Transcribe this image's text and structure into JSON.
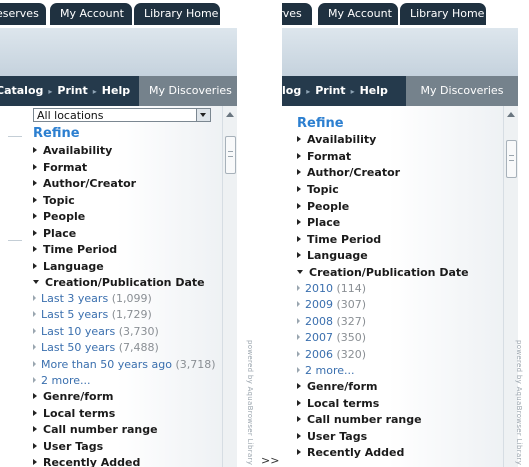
{
  "left": {
    "tabs": [
      {
        "label": "eserves"
      },
      {
        "label": "My Account"
      },
      {
        "label": "Library Home"
      }
    ],
    "nav": {
      "crumbs": [
        {
          "label": "Catalog"
        },
        {
          "label": "Print"
        },
        {
          "label": "Help"
        }
      ],
      "discoveries": "My Discoveries"
    },
    "location_select": {
      "value": "All locations"
    },
    "refine_title": "Refine",
    "facets_before": [
      {
        "label": "Availability"
      },
      {
        "label": "Format"
      },
      {
        "label": "Author/Creator"
      },
      {
        "label": "Topic"
      },
      {
        "label": "People"
      },
      {
        "label": "Place"
      },
      {
        "label": "Time Period"
      },
      {
        "label": "Language"
      }
    ],
    "open_facet": {
      "label": "Creation/Publication Date"
    },
    "sub_items": [
      {
        "label": "Last 3 years",
        "count": "(1,099)"
      },
      {
        "label": "Last 5 years",
        "count": "(1,729)"
      },
      {
        "label": "Last 10 years",
        "count": "(3,730)"
      },
      {
        "label": "Last 50 years",
        "count": "(7,488)"
      },
      {
        "label": "More than 50 years ago",
        "count": "(3,718)"
      }
    ],
    "more_link": "2 more...",
    "facets_after": [
      {
        "label": "Genre/form"
      },
      {
        "label": "Local terms"
      },
      {
        "label": "Call number range"
      },
      {
        "label": "User Tags"
      },
      {
        "label": "Recently Added"
      }
    ]
  },
  "right": {
    "tabs": [
      {
        "label": "rves"
      },
      {
        "label": "My Account"
      },
      {
        "label": "Library Home"
      }
    ],
    "nav": {
      "crumbs": [
        {
          "label": "log"
        },
        {
          "label": "Print"
        },
        {
          "label": "Help"
        }
      ],
      "discoveries": "My Discoveries"
    },
    "refine_title": "Refine",
    "facets_before": [
      {
        "label": "Availability"
      },
      {
        "label": "Format"
      },
      {
        "label": "Author/Creator"
      },
      {
        "label": "Topic"
      },
      {
        "label": "People"
      },
      {
        "label": "Place"
      },
      {
        "label": "Time Period"
      },
      {
        "label": "Language"
      }
    ],
    "open_facet": {
      "label": "Creation/Publication Date"
    },
    "sub_items": [
      {
        "label": "2010",
        "count": "(114)"
      },
      {
        "label": "2009",
        "count": "(307)"
      },
      {
        "label": "2008",
        "count": "(327)"
      },
      {
        "label": "2007",
        "count": "(350)"
      },
      {
        "label": "2006",
        "count": "(320)"
      }
    ],
    "more_link": "2 more...",
    "facets_after": [
      {
        "label": "Genre/form"
      },
      {
        "label": "Local terms"
      },
      {
        "label": "Call number range"
      },
      {
        "label": "User Tags"
      },
      {
        "label": "Recently Added"
      }
    ]
  },
  "arrow_between": ">>",
  "powered_by": "powered by AquaBrowser Library"
}
